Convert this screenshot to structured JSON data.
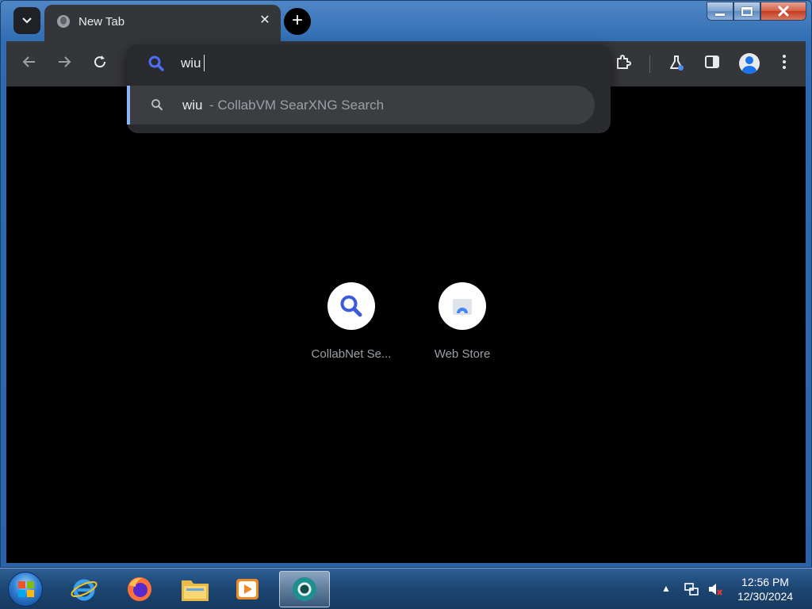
{
  "window": {
    "caption_buttons": {
      "minimize": "minimize",
      "maximize": "maximize",
      "close": "close"
    }
  },
  "tabs": [
    {
      "title": "New Tab",
      "favicon": "globe-icon",
      "active": true
    }
  ],
  "tab_close_glyph": "✕",
  "new_tab_glyph": "+",
  "toolbar": {
    "back_icon": "arrow-left-icon",
    "forward_icon": "arrow-right-icon",
    "reload_icon": "reload-icon",
    "right_icons": [
      "extensions-icon",
      "labs-icon",
      "side-panel-icon",
      "profile-icon",
      "menu-icon"
    ]
  },
  "omnibox": {
    "value": "wiu",
    "suggestion_query": "wiu",
    "suggestion_rest": "- CollabVM SearXNG Search"
  },
  "shortcuts": [
    {
      "label": "CollabNet Se...",
      "icon": "search-icon"
    },
    {
      "label": "Web Store",
      "icon": "web-store-icon"
    }
  ],
  "taskbar": {
    "pinned": [
      "internet-explorer-icon",
      "firefox-icon",
      "file-explorer-icon",
      "media-player-icon",
      "chromium-icon"
    ],
    "clock_time": "12:56 PM",
    "clock_date": "12/30/2024"
  },
  "colors": {
    "accent": "#8ab4f8",
    "search_icon_blue": "#4c6ef5",
    "toolbar_bg": "#35363a",
    "popup_bg": "#282a2d"
  }
}
